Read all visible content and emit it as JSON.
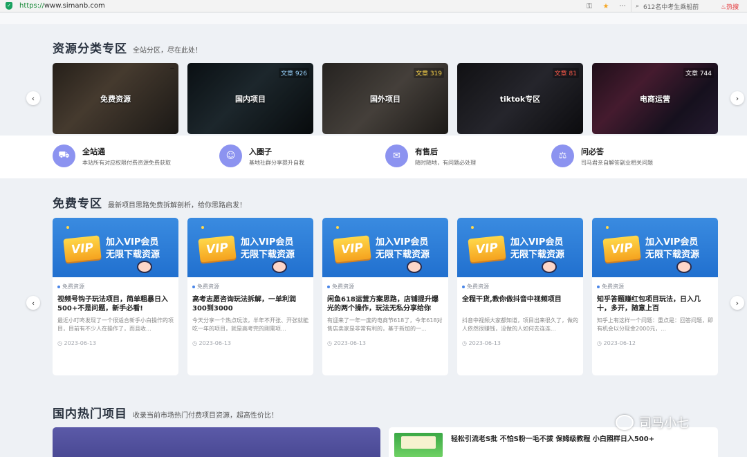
{
  "browser": {
    "url_protocol": "https://",
    "url_host": "www.simanb.com",
    "search_text": "612名中考生乘船前",
    "hot_label": "热搜"
  },
  "categories_section": {
    "title": "资源分类专区",
    "subtitle": "全站分区，尽在此处！",
    "cards": [
      {
        "label": "免费资源",
        "count": "",
        "count_color": "green"
      },
      {
        "label": "国内项目",
        "count": "文章 926",
        "count_color": "blue"
      },
      {
        "label": "国外项目",
        "count": "文章 319",
        "count_color": "yellow"
      },
      {
        "label": "tiktok专区",
        "count": "文章 81",
        "count_color": "red"
      },
      {
        "label": "电商运营",
        "count": "文章 744",
        "count_color": "white"
      }
    ]
  },
  "features": [
    {
      "icon": "car-icon",
      "title": "全站通",
      "desc": "本站所有对应权限付费资源免费获取"
    },
    {
      "icon": "smile-icon",
      "title": "入圈子",
      "desc": "基地社群分享提升自我"
    },
    {
      "icon": "chat-icon",
      "title": "有售后",
      "desc": "随时随地，有问题必处理"
    },
    {
      "icon": "qa-icon",
      "title": "问必答",
      "desc": "司马君亲自解答副业相关问题"
    }
  ],
  "free_section": {
    "title": "免费专区",
    "subtitle": "最新项目思路免费拆解剖析，给你思路启发！",
    "banner_line1": "加入VIP会员",
    "banner_line2": "无限下载资源",
    "badge": "VIP",
    "cards": [
      {
        "tag": "免费资源",
        "title": "视频号钩子玩法项目，简单粗暴日入500+不是问题，新手必看!",
        "excerpt": "最近小叮咚发现了一个很适合新手小白操作的项目，目前有不少人在操作了，而且收...",
        "date": "2023-06-13"
      },
      {
        "tag": "免费资源",
        "title": "高考志愿咨询玩法拆解，一单利润300到3000",
        "excerpt": "今天分享一个热点玩法，半年不开张、开张就能吃一年的项目，就是高考完的刚需项...",
        "date": "2023-06-13"
      },
      {
        "tag": "免费资源",
        "title": "闲鱼618运营方案思路，店铺提升爆光的两个操作，玩法无私分享给你",
        "excerpt": "有迎来了一年一度的电商节618了，今年618对售店卖家是非常有利的，基于新加的一...",
        "date": "2023-06-13"
      },
      {
        "tag": "免费资源",
        "title": "全程干货,教你做抖音中视频项目",
        "excerpt": "抖音中视频大家都知道，项目出来很久了，做的人依然很赚钱，没做的人如何去连连...",
        "date": "2023-06-13"
      },
      {
        "tag": "免费资源",
        "title": "知乎答题赚红包项目玩法，日入几十，多开，随意上百",
        "excerpt": "知乎上有这样一个问题：重点是：回答问题，即有机会以分现金2000元，...",
        "date": "2023-06-12"
      }
    ]
  },
  "hot_section": {
    "title": "国内热门项目",
    "subtitle": "收录当前市场热门付费项目资源，超高性价比！",
    "item_title": "轻松引流老S批 不怕S粉一毛不拔 保姆级教程 小白照样日入500+"
  },
  "watermark": "司马小七"
}
